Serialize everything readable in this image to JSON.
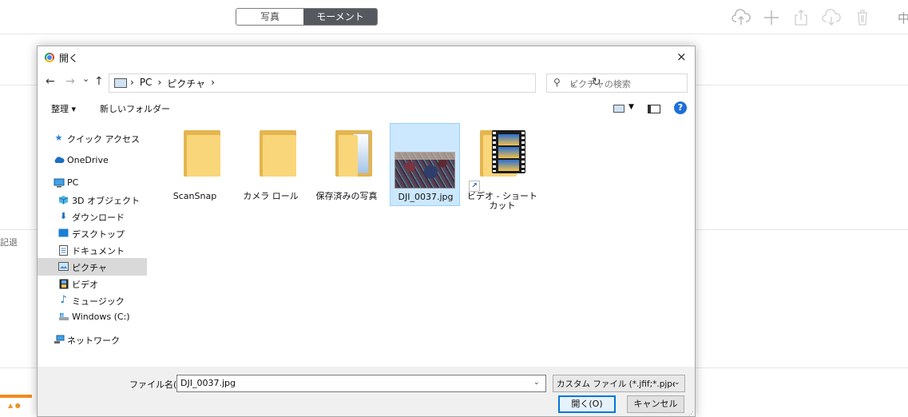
{
  "app": {
    "segments": [
      "写真",
      "モーメント"
    ],
    "toolbar_icons": [
      "upload-cloud-icon",
      "plus-icon",
      "share-icon",
      "download-cloud-icon",
      "trash-icon"
    ],
    "partial_right_char": "中",
    "partial_left_text": "記退"
  },
  "dialog": {
    "title": "開く",
    "close": "×",
    "nav": {
      "back": "←",
      "forward": "→",
      "recent": "⌄",
      "up": "↑",
      "dropdown": "⌄",
      "refresh": "↻"
    },
    "breadcrumb": [
      "›",
      "PC",
      "›",
      "ピクチャ",
      "›"
    ],
    "search_placeholder": "ピクチャの検索",
    "commands": {
      "organize": "整理 ▾",
      "new_folder": "新しいフォルダー",
      "help": "?"
    },
    "sidebar": [
      {
        "label": "クイック アクセス",
        "icon": "star-icon"
      },
      {
        "label": "OneDrive",
        "icon": "cloud-icon"
      },
      {
        "label": "PC",
        "icon": "pc-icon"
      },
      {
        "label": "3D オブジェクト",
        "icon": "cube-icon"
      },
      {
        "label": "ダウンロード",
        "icon": "download-arrow-icon"
      },
      {
        "label": "デスクトップ",
        "icon": "desktop-icon"
      },
      {
        "label": "ドキュメント",
        "icon": "document-icon"
      },
      {
        "label": "ピクチャ",
        "icon": "pictures-icon",
        "selected": true
      },
      {
        "label": "ビデオ",
        "icon": "video-icon"
      },
      {
        "label": "ミュージック",
        "icon": "music-icon"
      },
      {
        "label": "Windows (C:)",
        "icon": "drive-icon"
      },
      {
        "label": "ネットワーク",
        "icon": "network-icon"
      }
    ],
    "files": [
      {
        "name": "ScanSnap",
        "type": "folder"
      },
      {
        "name": "カメラ ロール",
        "type": "folder"
      },
      {
        "name": "保存済みの写真",
        "type": "folder-with-file"
      },
      {
        "name": "DJI_0037.jpg",
        "type": "image",
        "selected": true
      },
      {
        "name": "ビデオ - ショートカット",
        "type": "video-shortcut"
      }
    ],
    "filename_label": "ファイル名(N):",
    "filename_value": "DJI_0037.jpg",
    "filetype_value": "カスタム ファイル (*.jfif;*.pjpeg;*.jp",
    "open_button": "開く(O)",
    "cancel_button": "キャンセル"
  }
}
